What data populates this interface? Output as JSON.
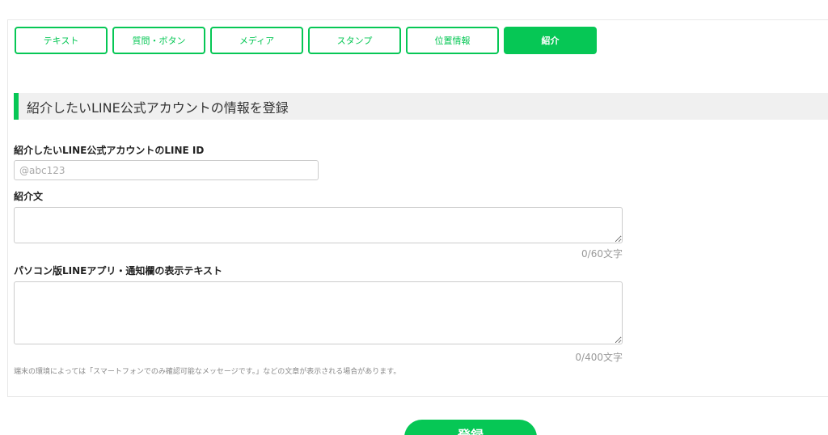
{
  "tabs": [
    {
      "label": "テキスト",
      "active": false
    },
    {
      "label": "質問・ボタン",
      "active": false
    },
    {
      "label": "メディア",
      "active": false
    },
    {
      "label": "スタンプ",
      "active": false
    },
    {
      "label": "位置情報",
      "active": false
    },
    {
      "label": "紹介",
      "active": true
    }
  ],
  "section": {
    "title": "紹介したいLINE公式アカウントの情報を登録"
  },
  "form": {
    "line_id_label": "紹介したいLINE公式アカウントのLINE ID",
    "line_id_value": "",
    "line_id_placeholder": "@abc123",
    "intro_label": "紹介文",
    "intro_value": "",
    "intro_counter": "0/60文字",
    "pc_label": "パソコン版LINEアプリ・通知欄の表示テキスト",
    "pc_value": "",
    "pc_counter": "0/400文字",
    "note": "端末の環境によっては「スマートフォンでのみ確認可能なメッセージです。」などの文章が表示される場合があります。"
  },
  "submit_label": "登録",
  "colors": {
    "accent": "#06c755",
    "section_bg": "#f0f0f0"
  }
}
